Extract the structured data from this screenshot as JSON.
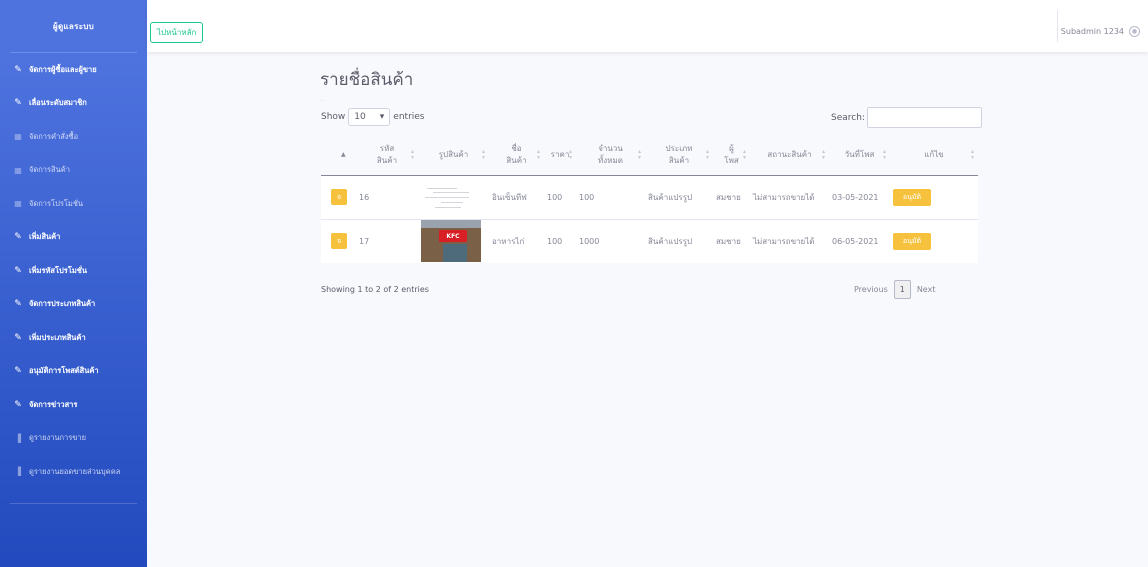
{
  "sidebar": {
    "brand": "ผู้ดูแลระบบ",
    "items": [
      {
        "label": "จัดการผู้ซื้อและผู้ขาย",
        "icon": "wrench-icon",
        "style": "bold"
      },
      {
        "label": "เลื่อนระดับสมาชิก",
        "icon": "wrench-icon",
        "style": "bold"
      },
      {
        "label": "จัดการคำสั่งซื้อ",
        "icon": "table-icon",
        "style": "light"
      },
      {
        "label": "จัดการสินค้า",
        "icon": "table-icon",
        "style": "light"
      },
      {
        "label": "จัดการโปรโมชั่น",
        "icon": "table-icon",
        "style": "light"
      },
      {
        "label": "เพิ่มสินค้า",
        "icon": "wrench-icon",
        "style": "bold"
      },
      {
        "label": "เพิ่มรหัสโปรโมชั่น",
        "icon": "wrench-icon",
        "style": "bold"
      },
      {
        "label": "จัดการประเภทสินค้า",
        "icon": "wrench-icon",
        "style": "bold"
      },
      {
        "label": "เพิ่มประเภทสินค้า",
        "icon": "wrench-icon",
        "style": "bold"
      },
      {
        "label": "อนุมัติการโพสต์สินค้า",
        "icon": "wrench-icon",
        "style": "bold"
      },
      {
        "label": "จัดการข่าวสาร",
        "icon": "wrench-icon",
        "style": "bold"
      },
      {
        "label": "ดูรายงานการขาย",
        "icon": "chart-icon",
        "style": "light"
      },
      {
        "label": "ดูรายงานยอดขายส่วนบุคคล",
        "icon": "chart-icon",
        "style": "light"
      }
    ]
  },
  "topbar": {
    "home_button": "ไปหน้าหลัก",
    "user_name": "Subadmin 1234"
  },
  "main": {
    "title": "รายชื่อสินค้า",
    "dot": ".",
    "length": {
      "show": "Show",
      "value": "10",
      "entries": "entries"
    },
    "search_label": "Search:",
    "table": {
      "headers": [
        {
          "l1": "",
          "l2": ""
        },
        {
          "l1": "รหัส",
          "l2": "สินค้า"
        },
        {
          "l1": "รูปสินค้า",
          "l2": ""
        },
        {
          "l1": "ชื่อ",
          "l2": "สินค้า"
        },
        {
          "l1": "ราคา",
          "l2": ""
        },
        {
          "l1": "จำนวน",
          "l2": "ทั้งหมด"
        },
        {
          "l1": "ประเภท",
          "l2": "สินค้า"
        },
        {
          "l1": "ผู้",
          "l2": "โพส"
        },
        {
          "l1": "สถานะสินค้า",
          "l2": ""
        },
        {
          "l1": "วันที่โพส",
          "l2": ""
        },
        {
          "l1": "แก้ไข",
          "l2": ""
        }
      ],
      "rows": [
        {
          "edit": "จ",
          "id": "16",
          "image": "pale-sketch-image",
          "name": "อินเซ็นทีฟ",
          "price": "100",
          "qty": "100",
          "type": "สินค้าแปรรูป",
          "poster": "สมชาย",
          "status": "ไม่สามารถขายได้",
          "date": "03-05-2021",
          "action": "อนุมัติ"
        },
        {
          "edit": "จ",
          "id": "17",
          "image": "kfc-store-image",
          "img_text": "KFC",
          "name": "อาหารไก่",
          "price": "100",
          "qty": "1000",
          "type": "สินค้าแปรรูป",
          "poster": "สมชาย",
          "status": "ไม่สามารถขายได้",
          "date": "06-05-2021",
          "action": "อนุมัติ"
        }
      ]
    },
    "info": "Showing 1 to 2 of 2 entries",
    "pager": {
      "prev": "Previous",
      "page": "1",
      "next": "Next"
    }
  }
}
